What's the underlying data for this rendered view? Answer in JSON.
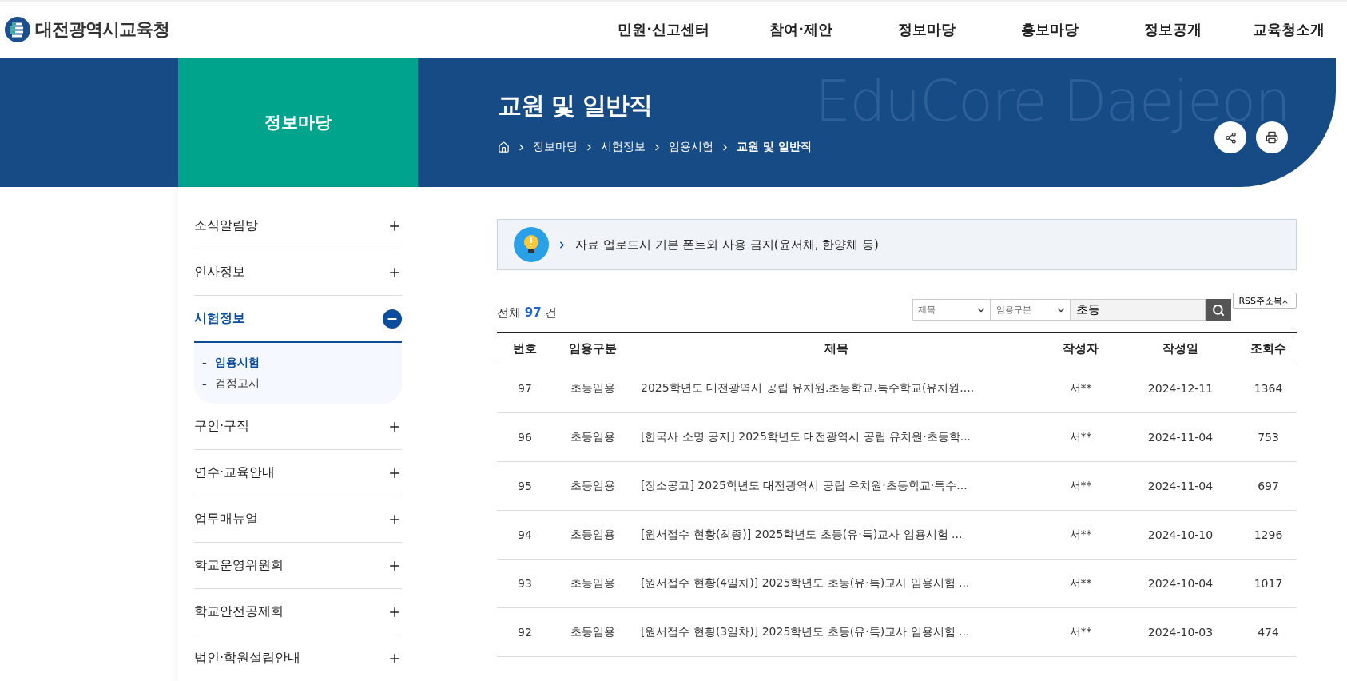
{
  "header": {
    "logo_text": "대전광역시교육청",
    "nav": [
      "민원·신고센터",
      "참여·제안",
      "정보마당",
      "홍보마당",
      "정보공개",
      "교육청소개"
    ]
  },
  "banner": {
    "section_title": "정보마당",
    "page_title": "교원 및 일반직",
    "decor_text": "EduCore Daejeon",
    "breadcrumb": [
      "정보마당",
      "시험정보",
      "임용시험",
      "교원 및 일반직"
    ]
  },
  "sidebar": {
    "items": [
      {
        "label": "소식알림방",
        "expanded": false
      },
      {
        "label": "인사정보",
        "expanded": false
      },
      {
        "label": "시험정보",
        "expanded": true,
        "children": [
          {
            "bullet": "-",
            "label": "임용시험",
            "selected": true
          },
          {
            "bullet": "-",
            "label": "검정고시",
            "selected": false
          }
        ]
      },
      {
        "label": "구인·구직",
        "expanded": false
      },
      {
        "label": "연수·교육안내",
        "expanded": false
      },
      {
        "label": "업무매뉴얼",
        "expanded": false
      },
      {
        "label": "학교운영위원회",
        "expanded": false
      },
      {
        "label": "학교안전공제회",
        "expanded": false
      },
      {
        "label": "법인·학원설립안내",
        "expanded": false
      }
    ]
  },
  "notice": "자료 업로드시 기본 폰트외 사용 금지(윤서체, 한양체 등)",
  "summary": {
    "prefix": "전체",
    "count": "97",
    "suffix": "건"
  },
  "search": {
    "field_select": "제목",
    "category_select": "임용구분",
    "query": "초등",
    "rss_button": "RSS주소복사"
  },
  "table": {
    "columns": [
      "번호",
      "임용구분",
      "제목",
      "작성자",
      "작성일",
      "조회수"
    ],
    "rows": [
      [
        "97",
        "초등임용",
        "2025학년도 대전광역시 공립 유치원.초등학교.특수학교(유치원....",
        "서**",
        "2024-12-11",
        "1364"
      ],
      [
        "96",
        "초등임용",
        "[한국사 소명 공지] 2025학년도 대전광역시 공립 유치원·초등학...",
        "서**",
        "2024-11-04",
        "753"
      ],
      [
        "95",
        "초등임용",
        "[장소공고] 2025학년도 대전광역시 공립 유치원·초등학교·특수...",
        "서**",
        "2024-11-04",
        "697"
      ],
      [
        "94",
        "초등임용",
        "[원서접수 현황(최종)] 2025학년도 초등(유·특)교사 임용시험 ...",
        "서**",
        "2024-10-10",
        "1296"
      ],
      [
        "93",
        "초등임용",
        "[원서접수 현황(4일차)] 2025학년도 초등(유·특)교사 임용시험 ...",
        "서**",
        "2024-10-04",
        "1017"
      ],
      [
        "92",
        "초등임용",
        "[원서접수 현황(3일차)] 2025학년도 초등(유·특)교사 임용시험 ...",
        "서**",
        "2024-10-03",
        "474"
      ]
    ]
  }
}
